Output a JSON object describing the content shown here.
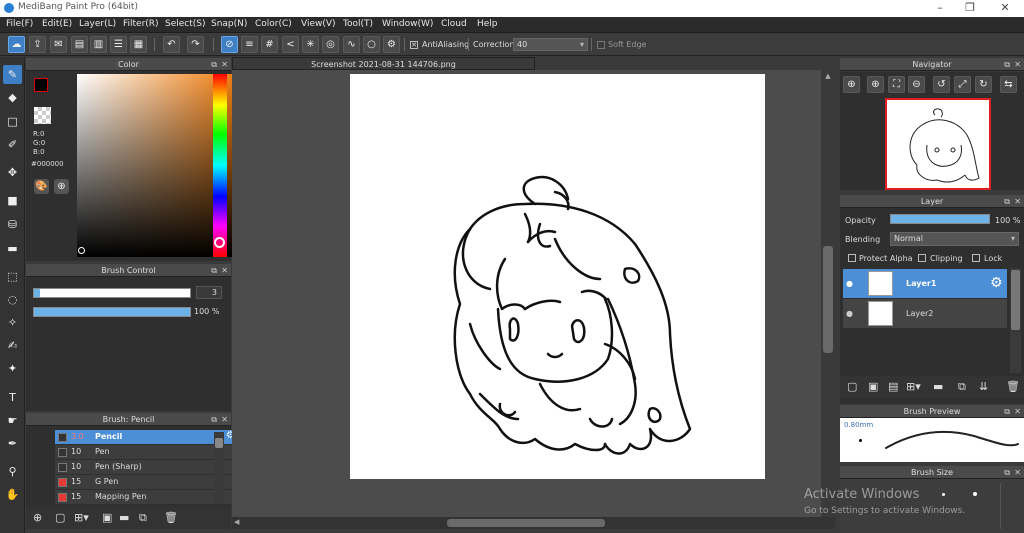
{
  "window": {
    "title": "MediBang Paint Pro (64bit)",
    "controls": [
      "–",
      "❐",
      "✕"
    ]
  },
  "menu": [
    "File(F)",
    "Edit(E)",
    "Layer(L)",
    "Filter(R)",
    "Select(S)",
    "Snap(N)",
    "Color(C)",
    "View(V)",
    "Tool(T)",
    "Window(W)",
    "Cloud",
    "Help"
  ],
  "toolbar": {
    "antialiasing_label": "AntiAliasing",
    "correction_label": "Correction",
    "correction_value": "40",
    "soft_edge_label": "Soft Edge"
  },
  "color_panel": {
    "title": "Color",
    "r_label": "R:0",
    "g_label": "G:0",
    "b_label": "B:0",
    "hex": "#000000"
  },
  "brush_control": {
    "title": "Brush Control",
    "size_value": "3",
    "opacity_value": "100 %"
  },
  "brush_panel": {
    "title": "Brush: Pencil",
    "items": [
      {
        "size": "3.0",
        "name": "Pencil",
        "color": "#333333",
        "selected": true
      },
      {
        "size": "10",
        "name": "Pen",
        "color": "#333333"
      },
      {
        "size": "10",
        "name": "Pen (Sharp)",
        "color": "#333333"
      },
      {
        "size": "15",
        "name": "G Pen",
        "color": "#e53935"
      },
      {
        "size": "15",
        "name": "Mapping Pen",
        "color": "#e53935"
      }
    ]
  },
  "document": {
    "tab_title": "Screenshot 2021-08-31 144706.png"
  },
  "navigator": {
    "title": "Navigator"
  },
  "layer_panel": {
    "title": "Layer",
    "opacity_label": "Opacity",
    "opacity_value": "100 %",
    "blending_label": "Blending",
    "blending_value": "Normal",
    "protect_alpha": "Protect Alpha",
    "clipping": "Clipping",
    "lock": "Lock",
    "layers": [
      {
        "name": "Layer1",
        "selected": true
      },
      {
        "name": "Layer2"
      }
    ]
  },
  "brush_preview": {
    "title": "Brush Preview",
    "size": "0.80mm"
  },
  "brush_size": {
    "title": "Brush Size"
  },
  "watermark": {
    "line1": "Activate Windows",
    "line2": "Go to Settings to activate Windows."
  },
  "colors": {
    "accent": "#3f7fc5",
    "panel_bg": "#2f2f2f",
    "header_bg": "#4a4a4a"
  }
}
